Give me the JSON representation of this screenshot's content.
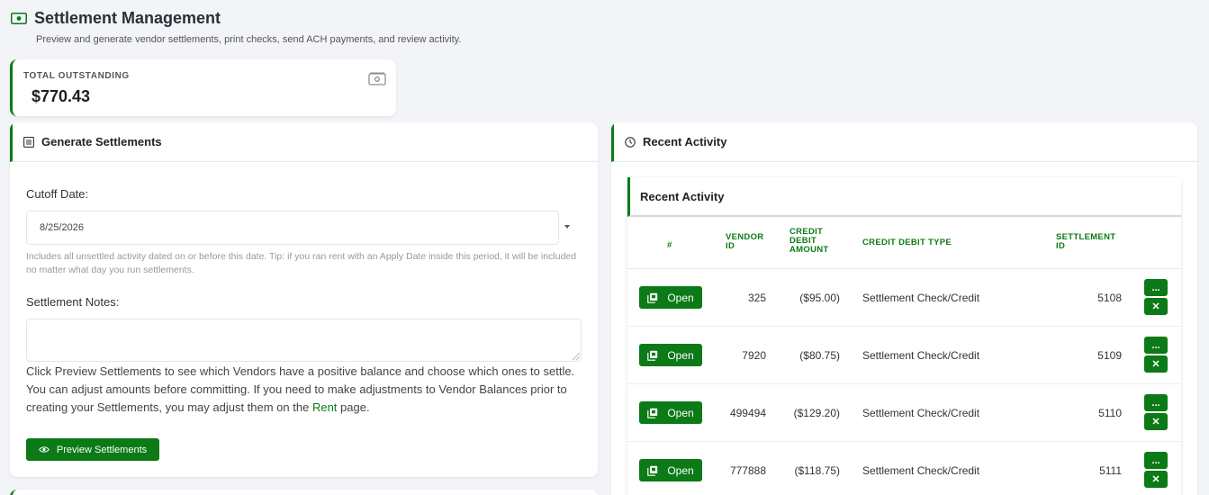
{
  "page": {
    "title": "Settlement Management",
    "subtitle": "Preview and generate vendor settlements, print checks, send ACH payments, and review activity."
  },
  "summary": {
    "label": "TOTAL OUTSTANDING",
    "value": "$770.43"
  },
  "generate": {
    "title": "Generate Settlements",
    "cutoff_label": "Cutoff Date:",
    "cutoff_value": "8/25/2026",
    "cutoff_help": "Includes all unsettled activity dated on or before this date. Tip: if you ran rent with an Apply Date inside this period, it will be included no matter what day you run settlements.",
    "notes_label": "Settlement Notes:",
    "notes_value": "",
    "description_before": "Click Preview Settlements to see which Vendors have a positive balance and choose which ones to settle. You can adjust amounts before committing. If you need to make adjustments to Vendor Balances prior to creating your Settlements, you may adjust them on the ",
    "description_link": "Rent",
    "description_after": " page.",
    "preview_button": "Preview Settlements"
  },
  "activity": {
    "panel_title": "Recent Activity",
    "card_title": "Recent Activity",
    "columns": {
      "index": "#",
      "vendor_id": [
        "VENDOR",
        "ID"
      ],
      "amount": [
        "CREDIT",
        "DEBIT",
        "AMOUNT"
      ],
      "type": "CREDIT DEBIT TYPE",
      "settlement_id": [
        "SETTLEMENT",
        "ID"
      ]
    },
    "open_label": "Open",
    "more_label": "...",
    "delete_label": "✕",
    "rows": [
      {
        "vendor_id": "325",
        "amount": "($95.00)",
        "type": "Settlement Check/Credit",
        "settlement_id": "5108"
      },
      {
        "vendor_id": "7920",
        "amount": "($80.75)",
        "type": "Settlement Check/Credit",
        "settlement_id": "5109"
      },
      {
        "vendor_id": "499494",
        "amount": "($129.20)",
        "type": "Settlement Check/Credit",
        "settlement_id": "5110"
      },
      {
        "vendor_id": "777888",
        "amount": "($118.75)",
        "type": "Settlement Check/Credit",
        "settlement_id": "5111"
      }
    ]
  },
  "colors": {
    "accent": "#0b7a17",
    "background": "#f2f4f8"
  },
  "icons": {
    "title": "money-icon",
    "summary": "money-icon",
    "generate": "list-icon",
    "activity": "clock-icon",
    "preview": "eye-icon",
    "open": "copy-icon",
    "more": "ellipsis-icon",
    "delete": "close-icon"
  }
}
